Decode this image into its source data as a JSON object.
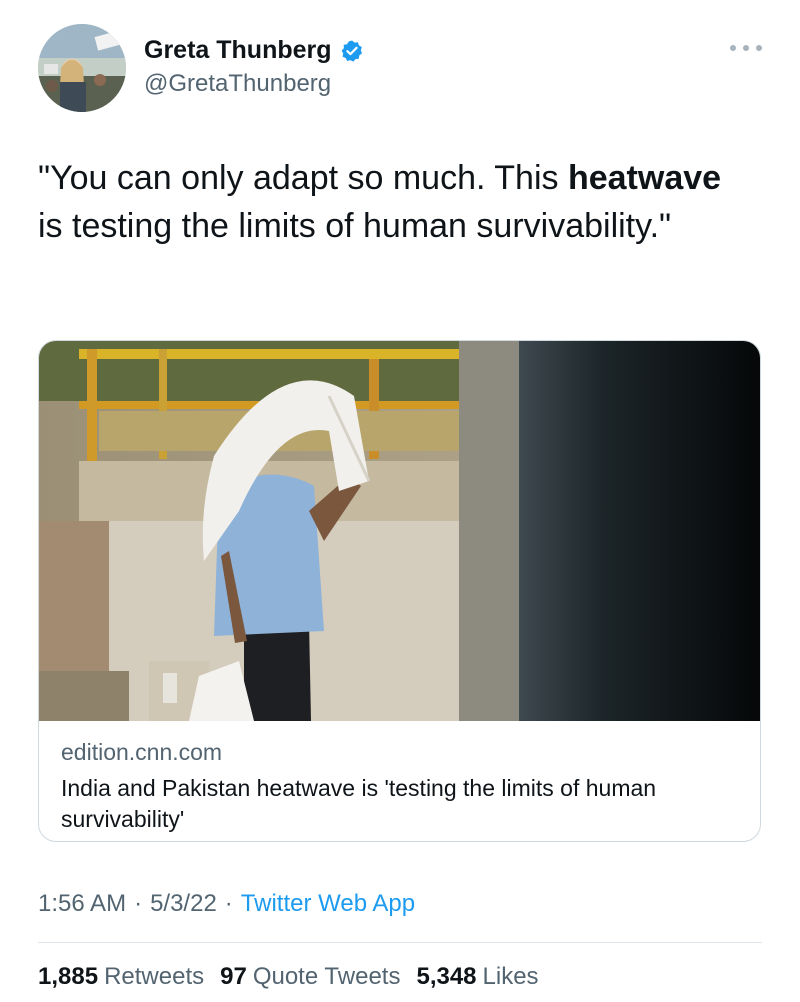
{
  "author": {
    "display_name": "Greta Thunberg",
    "handle": "@GretaThunberg",
    "verified_icon": "verified-badge-icon",
    "more_icon": "more-options-icon"
  },
  "tweet": {
    "text_before": "\"You can only adapt so much. This ",
    "text_bold": "heatwave",
    "text_after": " is testing the limits of human survivability.\""
  },
  "card": {
    "domain": "edition.cnn.com",
    "title": "India and Pakistan heatwave is 'testing the limits of human survivability'"
  },
  "meta": {
    "time": "1:56 AM",
    "separator": "·",
    "date": "5/3/22",
    "app": "Twitter Web App"
  },
  "stats": [
    {
      "count": "1,885",
      "label": "Retweets"
    },
    {
      "count": "97",
      "label": "Quote Tweets"
    },
    {
      "count": "5,348",
      "label": "Likes"
    }
  ],
  "colors": {
    "link": "#1d9bf0",
    "secondary": "#536471",
    "primary_text": "#0f1419",
    "border": "#cfd9de"
  }
}
